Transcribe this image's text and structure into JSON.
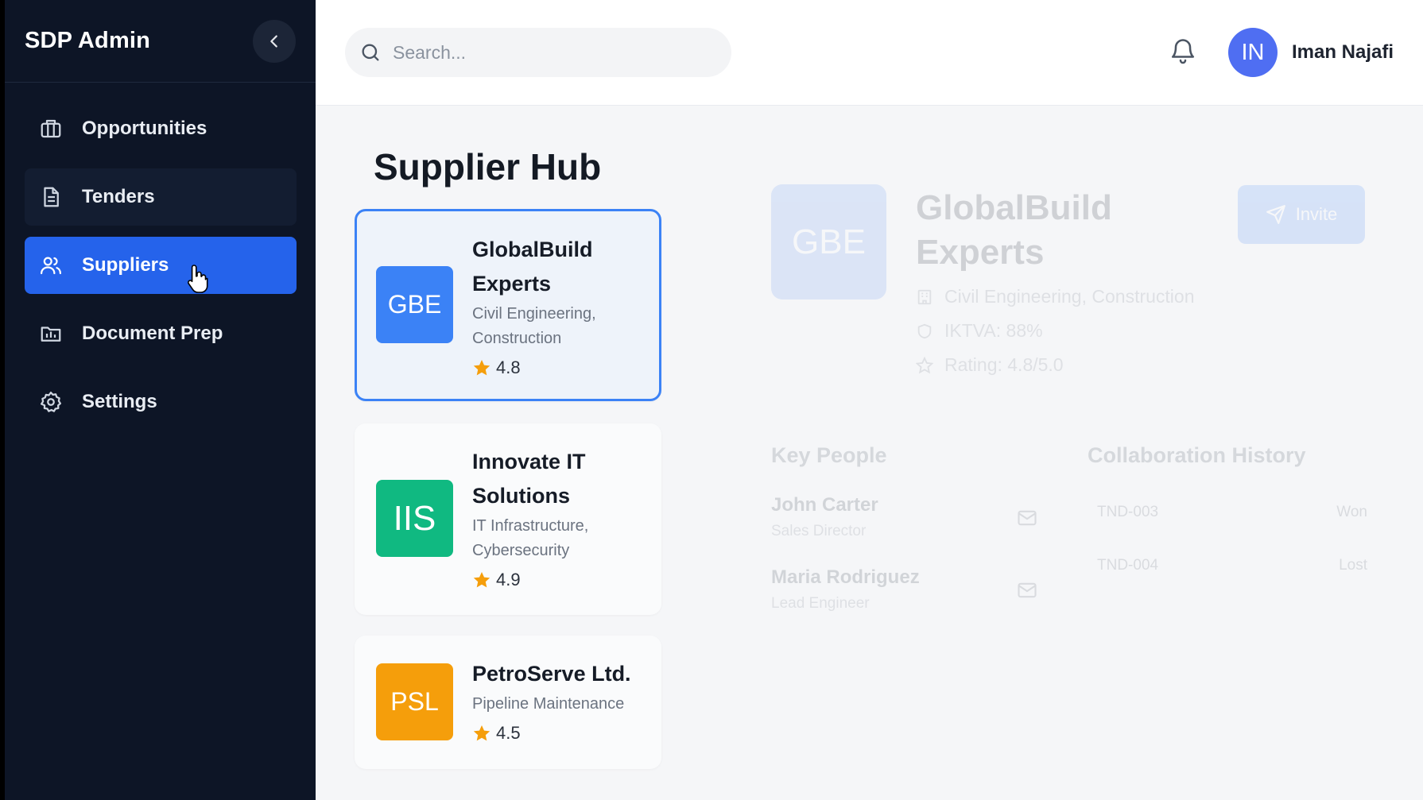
{
  "app": {
    "title": "SDP Admin"
  },
  "sidebar": {
    "items": [
      {
        "label": "Opportunities",
        "icon": "briefcase-icon"
      },
      {
        "label": "Tenders",
        "icon": "document-icon"
      },
      {
        "label": "Suppliers",
        "icon": "users-icon",
        "active": true
      },
      {
        "label": "Document Prep",
        "icon": "folder-icon"
      },
      {
        "label": "Settings",
        "icon": "gear-icon"
      }
    ]
  },
  "header": {
    "search_placeholder": "Search...",
    "user": {
      "initials": "IN",
      "name": "Iman Najafi"
    }
  },
  "main": {
    "title": "Supplier Hub",
    "suppliers": [
      {
        "initials": "GBE",
        "name": "GlobalBuild Experts",
        "tags": "Civil Engineering, Construction",
        "rating": "4.8",
        "color": "#3b82f6"
      },
      {
        "initials": "IIS",
        "name": "Innovate IT Solutions",
        "tags": "IT Infrastructure, Cybersecurity",
        "rating": "4.9",
        "color": "#10b981"
      },
      {
        "initials": "PSL",
        "name": "PetroServe Ltd.",
        "tags": "Pipeline Maintenance",
        "rating": "4.5",
        "color": "#f59e0b"
      }
    ]
  },
  "detail": {
    "initials": "GBE",
    "name": "GlobalBuild Experts",
    "invite_label": "Invite",
    "categories": "Civil Engineering, Construction",
    "iktva": "IKTVA: 88%",
    "rating": "Rating: 4.8/5.0",
    "key_people_heading": "Key People",
    "history_heading": "Collaboration History",
    "people": [
      {
        "name": "John Carter",
        "role": "Sales Director"
      },
      {
        "name": "Maria Rodriguez",
        "role": "Lead Engineer"
      }
    ],
    "history": [
      {
        "id": "TND-003",
        "status": "Won"
      },
      {
        "id": "TND-004",
        "status": "Lost"
      }
    ]
  },
  "colors": {
    "sidebar_bg": "#0d1526",
    "accent": "#2563eb",
    "star": "#f59e0b"
  }
}
